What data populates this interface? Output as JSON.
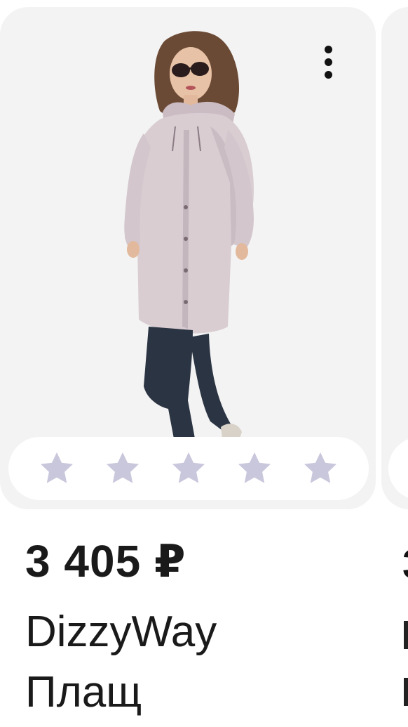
{
  "product": {
    "price": "3 405 ₽",
    "brand": "DizzyWay",
    "name": "Плащ",
    "image_alt": "woman in pale pink hooded raincoat and dark leggings"
  },
  "rating": {
    "stars": 5,
    "filled": 0,
    "star_color": "#c9c7dc"
  },
  "menu": {
    "icon": "more-vertical-icon"
  },
  "next_card": {
    "price_fragment": "3"
  },
  "colors": {
    "card_background": "#f3f3f3",
    "text": "#1a1a1a",
    "coat": "#d9cdd2",
    "leggings": "#2b3443"
  }
}
